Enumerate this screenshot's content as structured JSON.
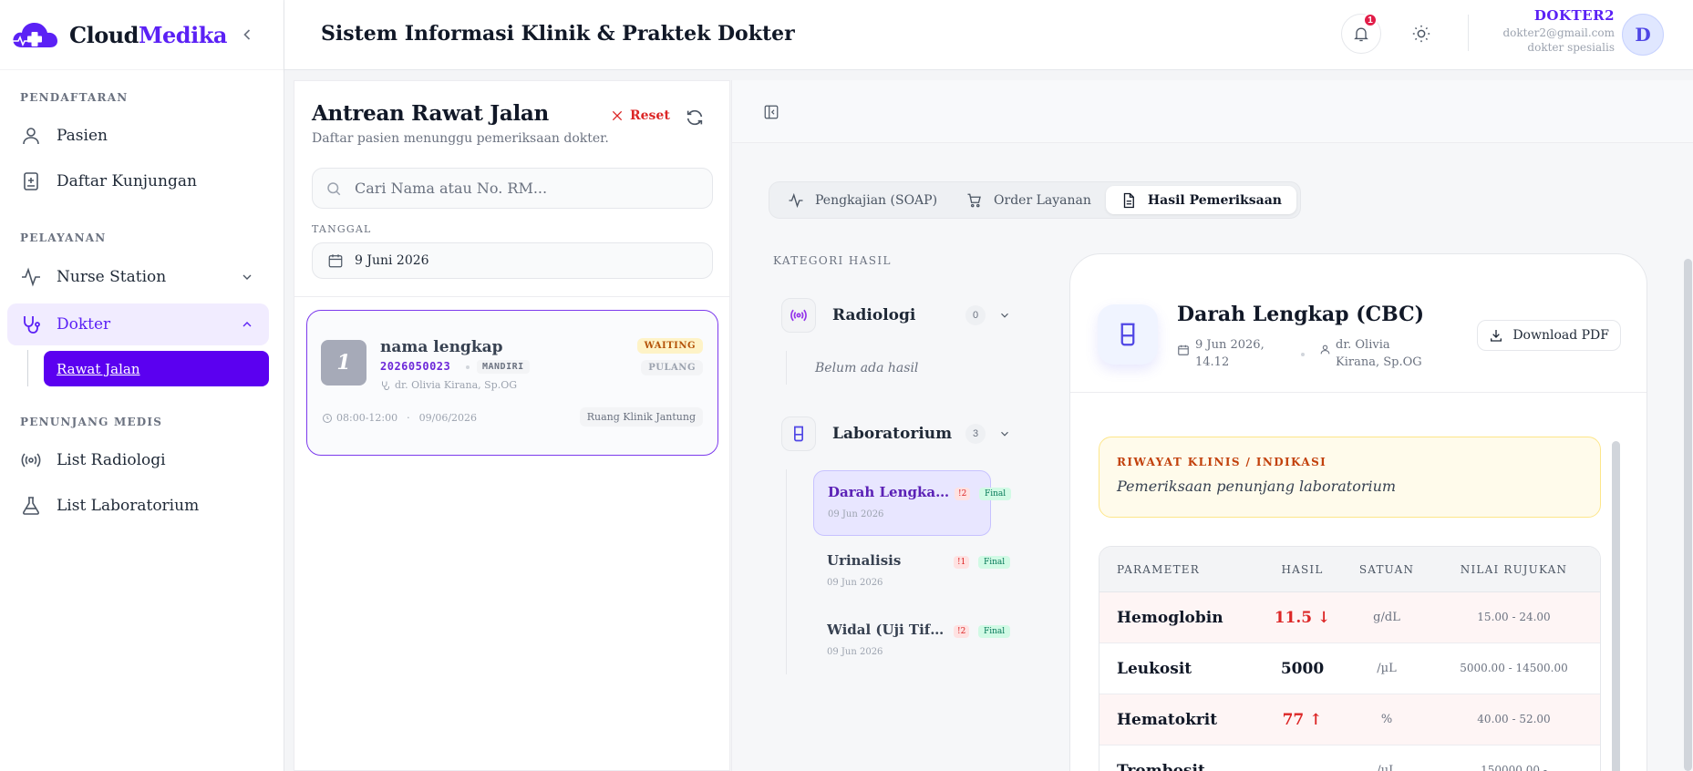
{
  "brand": {
    "name_part1": "Cloud",
    "name_part2": "Medika"
  },
  "sidebar": {
    "sections": [
      "PENDAFTARAN",
      "PELAYANAN",
      "PENUNJANG MEDIS"
    ],
    "items": [
      {
        "label": "Pasien",
        "icon": "user-icon"
      },
      {
        "label": "Daftar Kunjungan",
        "icon": "clipboard-plus-icon"
      },
      {
        "label": "Nurse Station",
        "icon": "activity-icon"
      },
      {
        "label": "Dokter",
        "icon": "stethoscope-icon",
        "active": true
      },
      {
        "label": "List Radiologi",
        "icon": "radio-icon"
      },
      {
        "label": "List Laboratorium",
        "icon": "flask-icon"
      }
    ],
    "subitem": "Rawat Jalan"
  },
  "header": {
    "title": "Sistem Informasi Klinik & Praktek Dokter",
    "notif_count": "1",
    "user": {
      "name": "DOKTER2",
      "email": "dokter2@gmail.com",
      "role": "dokter spesialis",
      "initial": "D"
    }
  },
  "queue": {
    "title": "Antrean Rawat Jalan",
    "subtitle": "Daftar pasien menunggu pemeriksaan dokter.",
    "reset_label": "Reset",
    "search_placeholder": "Cari Nama atau No. RM...",
    "date_label": "TANGGAL",
    "date_value": "9 Juni 2026",
    "patients": [
      {
        "number": "1",
        "name": "nama lengkap",
        "rm": "2026050023",
        "payment": "MANDIRI",
        "doctor": "dr. Olivia Kirana, Sp.OG",
        "status": "WAITING",
        "status2": "PULANG",
        "time": "08:00-12:00",
        "date": "09/06/2026",
        "room": "Ruang Klinik Jantung"
      }
    ]
  },
  "detail": {
    "tabs": [
      {
        "label": "Pengkajian (SOAP)",
        "icon": "activity-icon"
      },
      {
        "label": "Order Layanan",
        "icon": "cart-icon"
      },
      {
        "label": "Hasil Pemeriksaan",
        "icon": "document-icon",
        "active": true
      }
    ],
    "category_title": "KATEGORI HASIL",
    "categories": [
      {
        "name": "Radiologi",
        "count": "0",
        "empty_text": "Belum ada hasil"
      },
      {
        "name": "Laboratorium",
        "count": "3"
      }
    ],
    "lab_items": [
      {
        "name": "Darah Lengkap (CBC)",
        "date": "09 Jun 2026",
        "flag": "!2",
        "status": "Final",
        "selected": true
      },
      {
        "name": "Urinalisis",
        "date": "09 Jun 2026",
        "flag": "!1",
        "status": "Final"
      },
      {
        "name": "Widal (Uji Tifus)",
        "date": "09 Jun 2026",
        "flag": "!2",
        "status": "Final"
      }
    ],
    "result": {
      "title": "Darah Lengkap (CBC)",
      "date": "9 Jun 2026, 14.12",
      "doctor": "dr. Olivia Kirana, Sp.OG",
      "download_label": "Download PDF",
      "clinical_label": "RIWAYAT KLINIS / INDIKASI",
      "clinical_text": "Pemeriksaan penunjang laboratorium",
      "columns": [
        "PARAMETER",
        "HASIL",
        "SATUAN",
        "NILAI RUJUKAN"
      ],
      "rows": [
        {
          "param": "Hemoglobin",
          "value": "11.5 ↓",
          "unit": "g/dL",
          "ref": "15.00 - 24.00",
          "flag": "low"
        },
        {
          "param": "Leukosit",
          "value": "5000",
          "unit": "/µL",
          "ref": "5000.00 - 14500.00",
          "flag": "normal"
        },
        {
          "param": "Hematokrit",
          "value": "77 ↑",
          "unit": "%",
          "ref": "40.00 - 52.00",
          "flag": "high"
        },
        {
          "param": "Trombosit",
          "value": "",
          "unit": "/µL",
          "ref": "150000.00 -",
          "flag": "normal"
        }
      ]
    },
    "colors": {
      "accent": "#5b21f5",
      "danger": "#dc2626",
      "warning_bg": "#fffbeb"
    }
  }
}
